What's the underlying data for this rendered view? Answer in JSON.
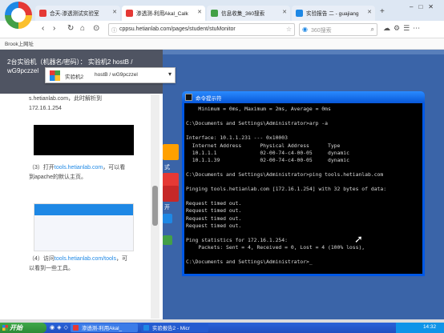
{
  "browser": {
    "tabs": [
      {
        "label": "合天-渗透测试实验室",
        "color": "#e53935",
        "active": false
      },
      {
        "label": "渗透测-利用Akal_Calk",
        "color": "#e53935",
        "active": true
      },
      {
        "label": "信息收集_360搜索",
        "color": "#43a047",
        "active": false
      },
      {
        "label": "实验报告 二 - guajiang",
        "color": "#1e88e5",
        "active": false
      }
    ],
    "url": "cppsu.hetianlab.com/pages/student/stuMonitor",
    "search_placeholder": "360搜索",
    "bookmark": "Brook上网址"
  },
  "left_panel": {
    "header_text": "2台实验机（机器名/密码）： 实验机2  hostB / wG9pczzel",
    "text1": "s.hetianlab.com，此时解析到172.16.1.254",
    "step3_prefix": "（3）打开",
    "step3_link": "tools.hetianlab.com",
    "step3_suffix": "，可以看到apache的默认主页。",
    "step4_prefix": "（4）访问",
    "step4_link": "tools.hetianlab.com/tools",
    "step4_suffix": "，可以看到一些工具。"
  },
  "remote_bar": {
    "label": "实验机2",
    "host": "hostB / wG9pczzel"
  },
  "desktop": {
    "icons": [
      {
        "label": "式",
        "color": "#ffa000"
      },
      {
        "label": "到",
        "color": "#e53935"
      },
      {
        "label": "开",
        "color": "#c62828"
      }
    ]
  },
  "cmd": {
    "title": "命令提示符",
    "lines": [
      "    Minimum = 0ms, Maximum = 2ms, Average = 0ms",
      "",
      "C:\\Documents and Settings\\Administrator>arp -a",
      "",
      "Interface: 10.1.1.231 --- 0x10003",
      "  Internet Address      Physical Address      Type",
      "  10.1.1.1              02-00-74-c4-00-05     dynamic",
      "  10.1.1.39             02-00-74-c4-00-05     dynamic",
      "",
      "C:\\Documents and Settings\\Administrator>ping tools.hetianlab.com",
      "",
      "Pinging tools.hetianlab.com [172.16.1.254] with 32 bytes of data:",
      "",
      "Request timed out.",
      "Request timed out.",
      "Request timed out.",
      "Request timed out.",
      "",
      "Ping statistics for 172.16.1.254:",
      "    Packets: Sent = 4, Received = 0, Lost = 4 (100% loss),",
      "",
      "C:\\Documents and Settings\\Administrator>_"
    ]
  },
  "taskbar": {
    "start_label": "开始",
    "tasks": [
      {
        "label": "渗透测-利用Akal_"
      },
      {
        "label": "实验报告2 - Micr"
      }
    ],
    "clock": "14:32"
  }
}
